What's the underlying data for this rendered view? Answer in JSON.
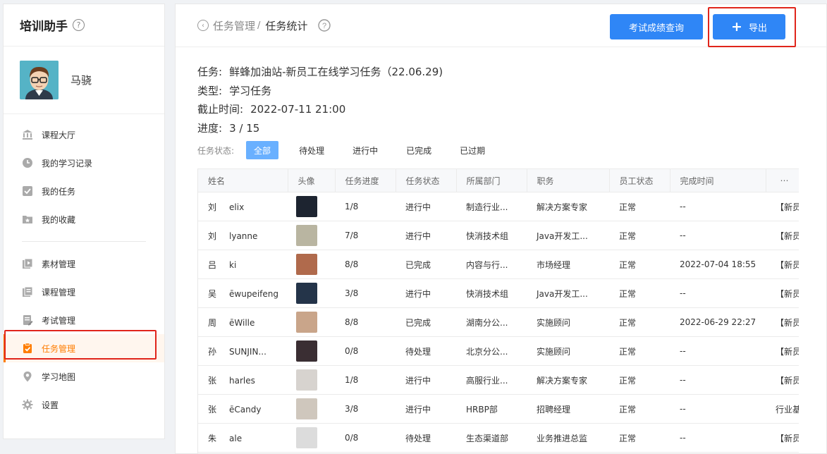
{
  "sidebar": {
    "brand": "培训助手",
    "user_name": "马骁",
    "items": [
      {
        "label": "课程大厅",
        "icon": "bank-icon"
      },
      {
        "label": "我的学习记录",
        "icon": "clock-icon"
      },
      {
        "label": "我的任务",
        "icon": "checkbox-icon"
      },
      {
        "label": "我的收藏",
        "icon": "star-folder-icon"
      },
      {
        "label": "素材管理",
        "icon": "media-icon"
      },
      {
        "label": "课程管理",
        "icon": "courses-icon"
      },
      {
        "label": "考试管理",
        "icon": "exam-icon"
      },
      {
        "label": "任务管理",
        "icon": "clipboard-check-icon"
      },
      {
        "label": "学习地图",
        "icon": "map-pin-icon"
      },
      {
        "label": "设置",
        "icon": "gear-icon"
      }
    ],
    "active_index": 7
  },
  "header": {
    "crumb_parent": "任务管理",
    "crumb_sep": "/",
    "crumb_current": "任务统计",
    "query_button": "考试成绩查询",
    "export_button": "导出"
  },
  "info": {
    "task_key": "任务:",
    "task_val": "鲜蜂加油站-新员工在线学习任务（22.06.29)",
    "type_key": "类型:",
    "type_val": "学习任务",
    "deadline_key": "截止时间:",
    "deadline_val": "2022-07-11 21:00",
    "progress_key": "进度:",
    "progress_val": "3 / 15"
  },
  "status_filter": {
    "label": "任务状态:",
    "options": [
      "全部",
      "待处理",
      "进行中",
      "已完成",
      "已过期"
    ],
    "selected": 0
  },
  "table": {
    "columns": [
      "姓名",
      "头像",
      "任务进度",
      "任务状态",
      "所属部门",
      "职务",
      "员工状态",
      "完成时间",
      "⋯"
    ],
    "rows": [
      {
        "name_a": "刘",
        "name_b": "elix",
        "progress": "1/8",
        "status": "进行中",
        "dept": "制造行业...",
        "title": "解决方案专家",
        "emp_status": "正常",
        "done_time": "--",
        "extra": "【新员",
        "avatar_color": "#1d2430"
      },
      {
        "name_a": "刘",
        "name_b": "lyanne",
        "progress": "7/8",
        "status": "进行中",
        "dept": "快消技术组",
        "title": "Java开发工...",
        "emp_status": "正常",
        "done_time": "--",
        "extra": "【新员",
        "avatar_color": "#b9b5a1"
      },
      {
        "name_a": "吕",
        "name_b": "ki",
        "progress": "8/8",
        "status": "已完成",
        "dept": "内容与行...",
        "title": "市场经理",
        "emp_status": "正常",
        "done_time": "2022-07-04 18:55",
        "extra": "【新员",
        "avatar_color": "#b06a4c"
      },
      {
        "name_a": "吴",
        "name_b": "ēwupeifeng",
        "progress": "3/8",
        "status": "进行中",
        "dept": "快消技术组",
        "title": "Java开发工...",
        "emp_status": "正常",
        "done_time": "--",
        "extra": "【新员",
        "avatar_color": "#243449"
      },
      {
        "name_a": "周",
        "name_b": "ēWille",
        "progress": "8/8",
        "status": "已完成",
        "dept": "湖南分公...",
        "title": "实施顾问",
        "emp_status": "正常",
        "done_time": "2022-06-29 22:27",
        "extra": "【新员",
        "avatar_color": "#c9a58a"
      },
      {
        "name_a": "孙",
        "name_b": "SUNJIN...",
        "progress": "0/8",
        "status": "待处理",
        "dept": "北京分公...",
        "title": "实施顾问",
        "emp_status": "正常",
        "done_time": "--",
        "extra": "【新员",
        "avatar_color": "#3a2e33"
      },
      {
        "name_a": "张",
        "name_b": "harles",
        "progress": "1/8",
        "status": "进行中",
        "dept": "高服行业...",
        "title": "解决方案专家",
        "emp_status": "正常",
        "done_time": "--",
        "extra": "【新员",
        "avatar_color": "#d7d3cf"
      },
      {
        "name_a": "张",
        "name_b": "ēCandy",
        "progress": "3/8",
        "status": "进行中",
        "dept": "HRBP部",
        "title": "招聘经理",
        "emp_status": "正常",
        "done_time": "--",
        "extra": "行业基",
        "avatar_color": "#cfc7bd"
      },
      {
        "name_a": "朱",
        "name_b": "ale",
        "progress": "0/8",
        "status": "待处理",
        "dept": "生态渠道部",
        "title": "业务推进总监",
        "emp_status": "正常",
        "done_time": "--",
        "extra": "【新员",
        "avatar_color": "#dcdcdc"
      }
    ]
  }
}
